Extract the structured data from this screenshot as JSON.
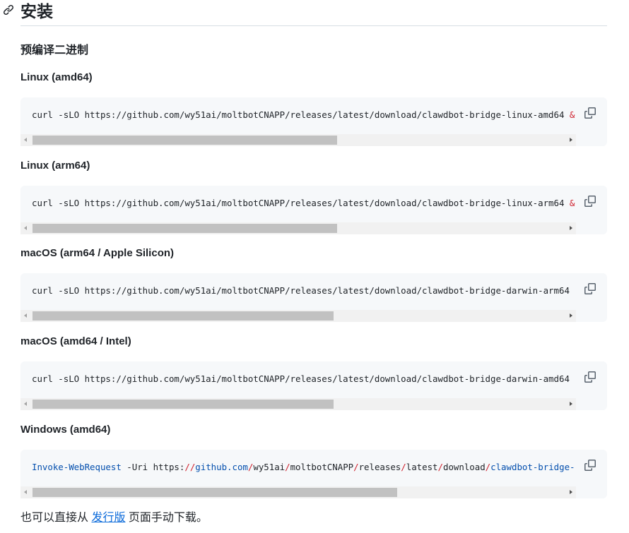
{
  "heading": {
    "title": "安装"
  },
  "subheading": "预编译二进制",
  "blocks": [
    {
      "label": "Linux (amd64)",
      "code_text": "curl -sLO https://github.com/wy51ai/moltbotCNAPP/releases/latest/download/clawdbot-bridge-linux-amd64 ",
      "code_tail": "&"
    },
    {
      "label": "Linux (arm64)",
      "code_text": "curl -sLO https://github.com/wy51ai/moltbotCNAPP/releases/latest/download/clawdbot-bridge-linux-arm64 ",
      "code_tail": "&"
    },
    {
      "label": "macOS (arm64 / Apple Silicon)",
      "code_text": "curl -sLO https://github.com/wy51ai/moltbotCNAPP/releases/latest/download/clawdbot-bridge-darwin-arm64",
      "code_tail": ""
    },
    {
      "label": "macOS (amd64 / Intel)",
      "code_text": "curl -sLO https://github.com/wy51ai/moltbotCNAPP/releases/latest/download/clawdbot-bridge-darwin-amd64",
      "code_tail": ""
    },
    {
      "label": "Windows (amd64)",
      "code_parts": {
        "cmd": "Invoke-WebRequest",
        "flag": " -Uri https:",
        "s1": "//",
        "p1": "github.com",
        "s2": "/",
        "p2": "wy51ai",
        "s3": "/",
        "p3": "moltbotCNAPP",
        "s4": "/",
        "p4": "releases",
        "s5": "/",
        "p5": "latest",
        "s6": "/",
        "p6": "download",
        "s7": "/",
        "p7": "clawdbot-bridge-"
      }
    }
  ],
  "footer": {
    "before": "也可以直接从 ",
    "link": "发行版",
    "after": " 页面手动下载。"
  },
  "colors": {
    "code_bg": "#f6f8fa",
    "link": "#0969da",
    "amp": "#cf222e",
    "cmd": "#0550ae"
  },
  "icons": [
    "link-icon",
    "copy-icon",
    "scroll-left-arrow",
    "scroll-right-arrow"
  ]
}
